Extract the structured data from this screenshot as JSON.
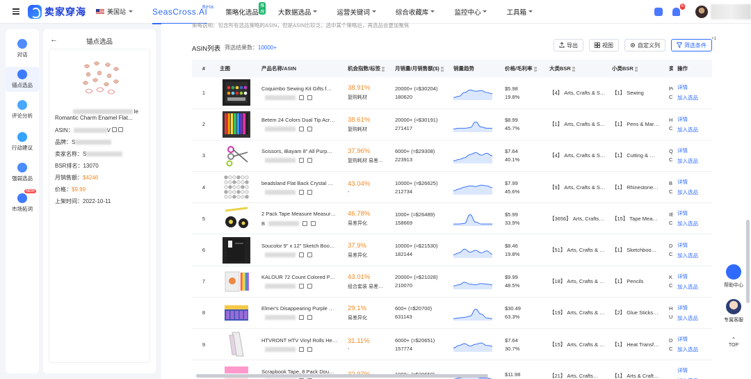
{
  "topbar": {
    "logo_text": "卖家穿海",
    "region": "美国站",
    "brand": "SeasCross.AI",
    "beta": "Beta",
    "nav": [
      {
        "label": "策略化选品",
        "badge": "推荐",
        "has_caret": false
      },
      {
        "label": "大数据选品",
        "has_caret": true
      },
      {
        "label": "运营关键词",
        "has_caret": true
      },
      {
        "label": "综合收藏库",
        "has_caret": true
      },
      {
        "label": "监控中心",
        "has_caret": true
      },
      {
        "label": "工具箱",
        "has_caret": true
      }
    ],
    "notification_count": "6"
  },
  "rail": [
    {
      "label": "对话",
      "active": false
    },
    {
      "label": "锚点选品",
      "active": true
    },
    {
      "label": "评论分析",
      "active": false
    },
    {
      "label": "行动建议",
      "active": false
    },
    {
      "label": "强弱选品",
      "active": false
    },
    {
      "label": "市场拓词",
      "active": false,
      "badge": "NEW"
    }
  ],
  "panel": {
    "title": "锚点选品",
    "product_name_end": "le",
    "product_name": "Romantic Charm Enamel Flat...",
    "fields": [
      {
        "key": "ASIN：",
        "value": "",
        "blurred": true,
        "suffix": "V"
      },
      {
        "key": "品牌：",
        "value": "S",
        "blurred": true
      },
      {
        "key": "卖家名称：",
        "value": "S",
        "blurred": true
      },
      {
        "key": "BSR排名：",
        "value": "13070"
      },
      {
        "key": "月销售额：",
        "value": "$4246",
        "accent": true
      },
      {
        "key": "价格：",
        "value": "$9.99",
        "accent": true
      },
      {
        "key": "上架时间：",
        "value": "2022-10-11"
      }
    ]
  },
  "main": {
    "strategy_note": "策略说明：包含所有选品策略的ASIN，但是ASIN比较泛，选中某个策略后，再选品会更加聚焦",
    "list_title": "ASIN列表",
    "result_label": "筛选结果数：",
    "result_value": "10000+",
    "buttons": {
      "export": "导出",
      "view": "视图",
      "custom_cols": "自定义列",
      "filter": "筛选条件"
    },
    "filter_count": "+1",
    "columns": [
      "#",
      "主图",
      "产品名称/ASIN",
      "机会指数/标签",
      "月销量/月销售额($)",
      "销量趋势",
      "价格/毛利率",
      "大类BSR",
      "小类BSR",
      "卖",
      "操作"
    ],
    "rows": [
      {
        "idx": "1",
        "name": "Coquimbo Sewing Kit Gifts f…",
        "asin_start": "",
        "opp": "38.91%",
        "tag": "复购耗材",
        "sales": "20000+ (≈$30204)",
        "revenue": "180620",
        "price": "$5.98",
        "margin": "19.8%",
        "bsr_big": "【4】 Arts, Crafts & S…",
        "bsr_small": "【1】 Sewing",
        "seller": "Pc",
        "seller2": "C",
        "trend": [
          0.1,
          0.2,
          0.5,
          0.7,
          0.6,
          0.65,
          0.5,
          0.4
        ]
      },
      {
        "idx": "2",
        "name": "Betem 24 Colors Dual Tip Acr…",
        "asin_start": "",
        "opp": "38.61%",
        "tag": "复购耗材",
        "sales": "20000+ (≈$30191)",
        "revenue": "271417",
        "price": "$8.99",
        "margin": "45.7%",
        "bsr_big": "【1】 Arts, Crafts & S…",
        "bsr_small": "【1】 Pens & Mar…",
        "seller": "H",
        "seller2": "C",
        "trend": [
          0.15,
          0.2,
          0.2,
          0.25,
          0.7,
          0.3,
          0.2,
          0.2
        ]
      },
      {
        "idx": "3",
        "name": "Scissors, iBayam 8\" All Purp…",
        "asin_start": "",
        "opp": "37.96%",
        "tag": "复购耗材 易差…",
        "sales": "6000+ (≈$29308)",
        "revenue": "223913",
        "price": "$7.64",
        "margin": "40.1%",
        "bsr_big": "【4】 Arts, Crafts & S…",
        "bsr_small": "【1】 Cutting & …",
        "seller": "Q",
        "seller2": "C",
        "trend": [
          0.1,
          0.2,
          0.35,
          0.6,
          0.75,
          0.55,
          0.7,
          0.5
        ]
      },
      {
        "idx": "4",
        "name": "beadsland Flat Back Crystal …",
        "asin_start": "",
        "opp": "43.04%",
        "tag": "-",
        "sales": "10000+ (≈$26625)",
        "revenue": "212734",
        "price": "$7.99",
        "margin": "45.6%",
        "bsr_big": "【9】 Arts, Crafts & S…",
        "bsr_small": "【1】 Rhinestone…",
        "seller": "B",
        "seller2": "C",
        "trend": [
          0.2,
          0.35,
          0.5,
          0.6,
          0.55,
          0.65,
          0.6,
          0.45
        ]
      },
      {
        "idx": "5",
        "name": "2 Pack Tape Measure Measur…",
        "asin_start": "B",
        "opp": "46.78%",
        "tag": "易差异化",
        "sales": "1000+ (≈$26489)",
        "revenue": "158669",
        "price": "$5.99",
        "margin": "33.9%",
        "bsr_big": "【3656】 Arts, Crafts…",
        "bsr_small": "【15】 Tape Mea…",
        "seller": "IE",
        "seller2": "C",
        "trend": [
          0.05,
          0.05,
          0.1,
          0.8,
          0.2,
          0.05,
          0.05,
          0.05
        ]
      },
      {
        "idx": "6",
        "name": "Soucolor 9\" x 12\" Sketch Boo…",
        "asin_start": "",
        "opp": "37.9%",
        "tag": "易差异化",
        "sales": "10000+ (≈$21530)",
        "revenue": "182144",
        "price": "$8.46",
        "margin": "19.8%",
        "bsr_big": "【51】 Arts, Crafts & …",
        "bsr_small": "【1】 Sketchboo…",
        "seller": "D",
        "seller2": "C",
        "trend": [
          0.15,
          0.3,
          0.6,
          0.35,
          0.5,
          0.3,
          0.45,
          0.2
        ]
      },
      {
        "idx": "7",
        "name": "KALOUR 72 Count Colored P…",
        "asin_start": "",
        "opp": "43.01%",
        "tag": "组合套装 易差…",
        "sales": "20000+ (≈$21028)",
        "revenue": "210070",
        "price": "$9.99",
        "margin": "48.5%",
        "bsr_big": "【18】 Arts, Crafts & …",
        "bsr_small": "【1】 Pencils",
        "seller": "K",
        "seller2": "C",
        "trend": [
          0.15,
          0.25,
          0.45,
          0.3,
          0.25,
          0.35,
          0.3,
          0.25
        ]
      },
      {
        "idx": "8",
        "name": "Elmer's Disappearing Purple …",
        "asin_start": "",
        "opp": "29.1%",
        "tag": "易差异化",
        "sales": "600+ (≈$20700)",
        "revenue": "631143",
        "price": "$30.49",
        "margin": "63.3%",
        "bsr_big": "【19】 Arts, Crafts & …",
        "bsr_small": "【2】 Glue Sticks…",
        "seller": "H",
        "seller2": "U",
        "trend": [
          0.05,
          0.1,
          0.15,
          0.25,
          0.8,
          0.4,
          0.1,
          0.05
        ]
      },
      {
        "idx": "9",
        "name": "HTVRONT HTV Vinyl Rolls He…",
        "asin_start": "",
        "opp": "31.11%",
        "tag": "-",
        "sales": "6000+ (≈$20651)",
        "revenue": "157774",
        "price": "$7.64",
        "margin": "30.7%",
        "bsr_big": "【15】 Arts, Crafts & …",
        "bsr_small": "【1】 Heat Transf…",
        "seller": "D",
        "seller2": "C",
        "trend": [
          0.2,
          0.4,
          0.55,
          0.35,
          0.5,
          0.6,
          0.4,
          0.35
        ]
      },
      {
        "idx": "10",
        "name": "Scrapbook Tape, 8 Pack Dou…",
        "asin_start": "",
        "opp": "32.97%",
        "tag": "",
        "sales": "1000+ (≈$20650)",
        "revenue": "",
        "price": "$11.98",
        "margin": "",
        "bsr_big": "【21】 Arts, Crafts…",
        "bsr_small": "【1】 Arts & Craft…",
        "seller": "",
        "seller2": "",
        "trend": [
          0.2,
          0.3,
          0.4,
          0.5,
          0.4,
          0.3,
          0.3,
          0.2
        ]
      }
    ],
    "op_detail": "详情",
    "op_add": "加入选品"
  },
  "floaters": {
    "help": "帮助中心",
    "service": "专属客服",
    "top": "TOP"
  },
  "colors": {
    "accent": "#2f6bff",
    "orange": "#f08a24",
    "badge_red": "#f23c3c",
    "hot_green": "#19b86a"
  }
}
